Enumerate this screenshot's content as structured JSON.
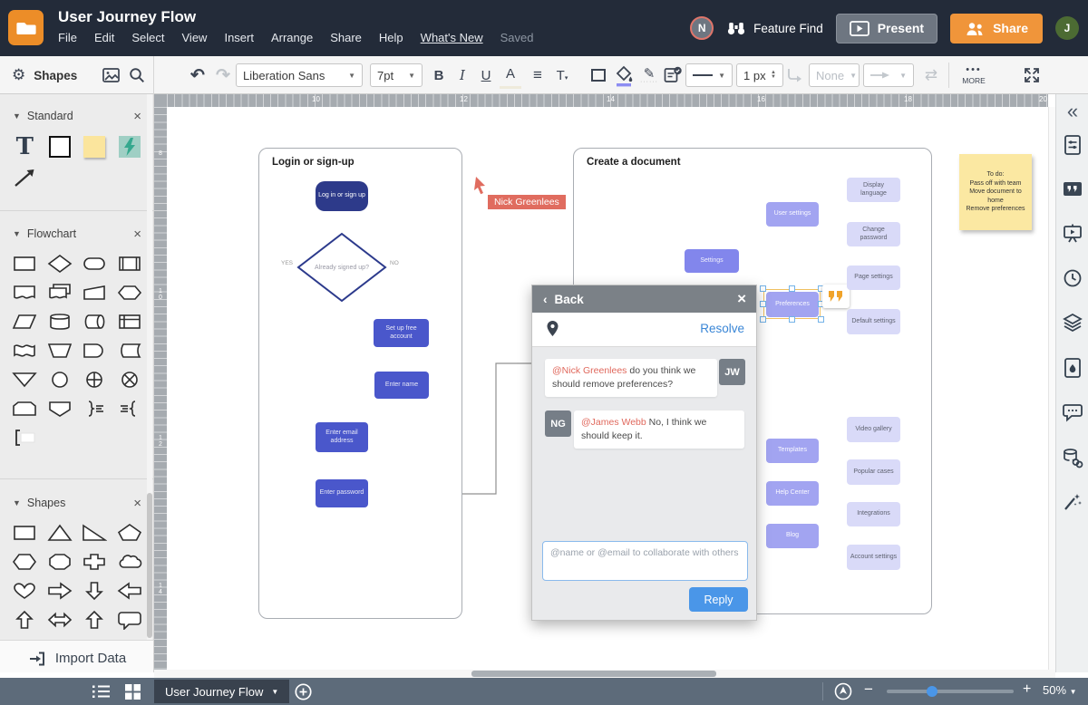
{
  "header": {
    "title": "User Journey Flow",
    "menu": [
      "File",
      "Edit",
      "Select",
      "View",
      "Insert",
      "Arrange",
      "Share",
      "Help",
      "What's New",
      "Saved"
    ],
    "feature_find": "Feature Find",
    "present": "Present",
    "share": "Share",
    "avatar_n": "N",
    "avatar_j": "J"
  },
  "toolbar": {
    "font": "Liberation Sans",
    "font_size": "7pt",
    "stroke_width": "1 px",
    "line_end_none": "None",
    "more": "MORE"
  },
  "sidebar": {
    "panel_title": "Shapes",
    "sections": {
      "standard": "Standard",
      "flowchart": "Flowchart",
      "shapes": "Shapes"
    },
    "standard_shapes": [
      "text",
      "rectangle",
      "sticky-note",
      "lightning-bolt",
      "arrow"
    ],
    "flowchart_shapes": [
      "process",
      "decision",
      "terminator",
      "predefined-process",
      "document",
      "multiple-documents",
      "manual-input",
      "preparation",
      "data",
      "database",
      "direct-access-storage",
      "internal-storage",
      "tape",
      "manual-operation",
      "delay",
      "stored-data",
      "merge",
      "connector",
      "or",
      "summing-junction",
      "loop-limit",
      "off-page-connector",
      "brace-right",
      "brace-left",
      "note-bracket"
    ],
    "basic_shapes": [
      "rectangle",
      "triangle",
      "right-triangle",
      "pentagon",
      "hexagon",
      "octagon",
      "cross",
      "cloud",
      "heart",
      "arrow-right",
      "arrow-down",
      "arrow-left",
      "arrow-up",
      "arrow-both",
      "arrow-up-2",
      "callout"
    ],
    "import_data": "Import Data"
  },
  "canvas": {
    "rulers": {
      "h": [
        "10",
        "12",
        "14",
        "16",
        "18",
        "20"
      ],
      "v": [
        "8",
        "1\n0",
        "1\n2",
        "1\n4"
      ]
    },
    "login_flow": {
      "title": "Login or sign-up",
      "nodes": {
        "start": "Log in or sign up",
        "decision": "Already signed up?",
        "yes": "YES",
        "no": "NO",
        "setup": "Set up free account",
        "name": "Enter name",
        "email": "Enter email address",
        "password": "Enter password"
      }
    },
    "create_flow": {
      "title": "Create a document",
      "nodes": {
        "settings": "Settings",
        "user_settings": "User settings",
        "display_language": "Display language",
        "change_password": "Change password",
        "preferences": "Preferences",
        "page_settings": "Page settings",
        "default_settings": "Default settings",
        "templates": "Templates",
        "help_center": "Help Center",
        "blog": "Blog",
        "video_gallery": "Video gallery",
        "popular_cases": "Popular cases",
        "integrations": "Integrations",
        "account_settings": "Account settings"
      }
    },
    "sticky_note": "To do:\nPass off with team\nMove document to home\nRemove preferences",
    "collaborator_cursor": "Nick Greenlees"
  },
  "comment_dialog": {
    "back": "Back",
    "resolve": "Resolve",
    "messages": [
      {
        "avatar": "JW",
        "mention": "@Nick Greenlees",
        "text": " do you think we should remove preferences?"
      },
      {
        "avatar": "NG",
        "mention": "@James Webb",
        "text": " No, I think we should keep it."
      }
    ],
    "input_placeholder": "@name or @email to collaborate with others",
    "reply": "Reply"
  },
  "bottom_bar": {
    "page_name": "User Journey Flow",
    "zoom": "50%"
  },
  "colors": {
    "header_bg": "#232b39",
    "accent_orange": "#f0953a",
    "node_navy": "#2d3a8a",
    "node_blue": "#4a57cb",
    "node_purple": "#8286ec",
    "node_mid_purple": "#a2a4f1",
    "node_light_purple": "#d9daf8",
    "collaborator_red": "#e06c5f",
    "reply_blue": "#4a96e8",
    "sticky_yellow": "#fbe8a2",
    "selection_handle_blue": "#74b3e8",
    "comment_quote_orange": "#f0a32a"
  }
}
